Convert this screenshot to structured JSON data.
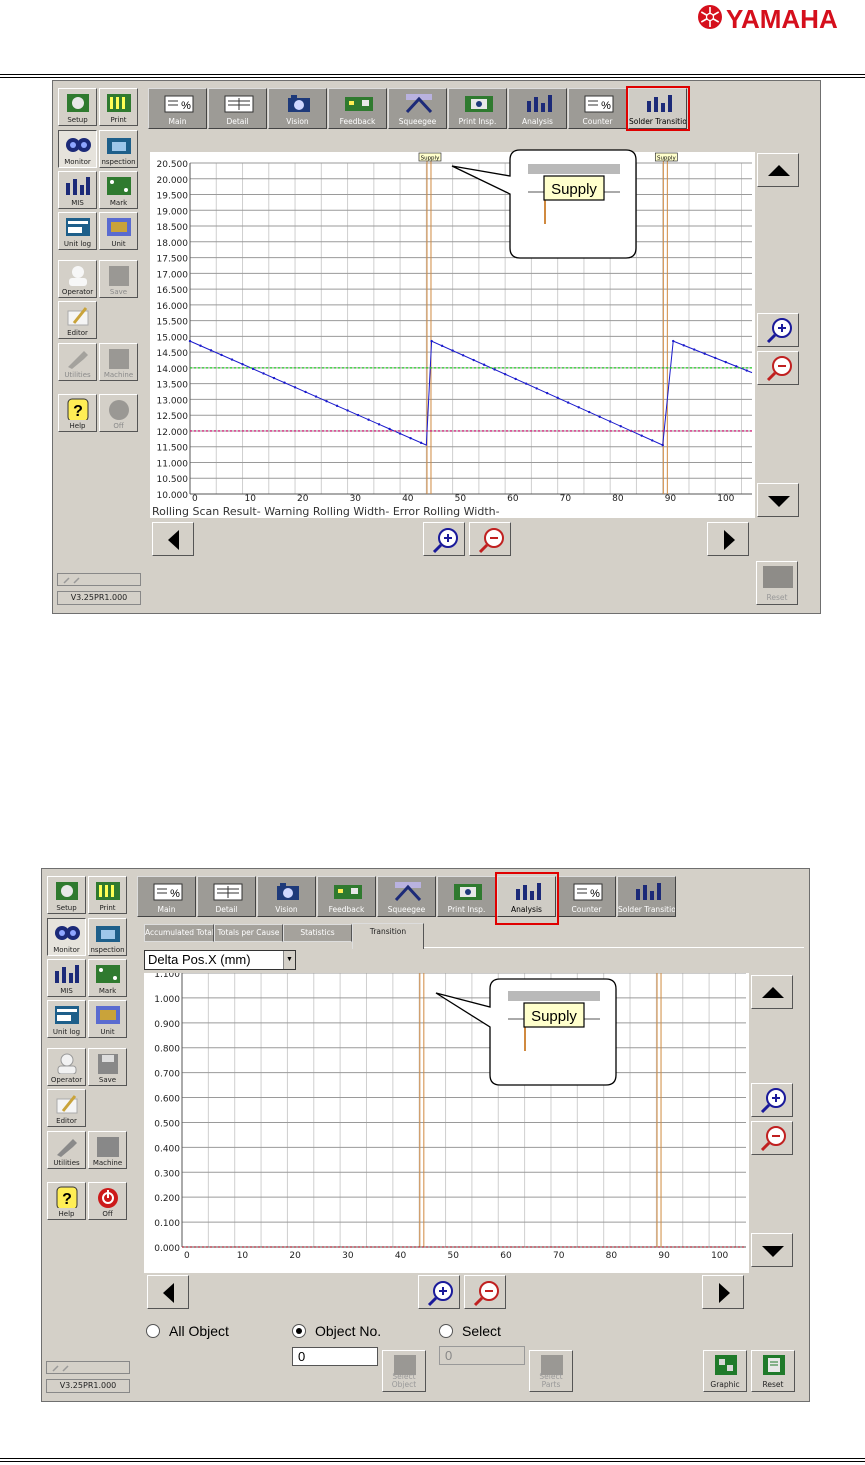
{
  "brand": {
    "name": "YAMAHA"
  },
  "colors": {
    "tab_bg": "#9d9b96",
    "highlight": "#e00000",
    "series": "#1a1acc",
    "warning": "#22cc22",
    "error": "#cc2277",
    "marker": "#d08a40"
  },
  "sidebar": {
    "items": [
      {
        "id": "setup",
        "label": "Setup",
        "icon": "setup-icon"
      },
      {
        "id": "print",
        "label": "Print",
        "icon": "print-icon"
      },
      {
        "id": "monitor",
        "label": "Monitor",
        "icon": "monitor-icon"
      },
      {
        "id": "inspection",
        "label": "nspection",
        "icon": "inspection-icon"
      },
      {
        "id": "mis",
        "label": "MIS",
        "icon": "mis-icon"
      },
      {
        "id": "mark",
        "label": "Mark",
        "icon": "mark-icon"
      },
      {
        "id": "unitlog",
        "label": "Unit log",
        "icon": "unit-log-icon"
      },
      {
        "id": "unit",
        "label": "Unit",
        "icon": "unit-icon"
      },
      {
        "id": "operator",
        "label": "Operator",
        "icon": "operator-icon"
      },
      {
        "id": "save",
        "label": "Save",
        "icon": "save-icon"
      },
      {
        "id": "editor",
        "label": "Editor",
        "icon": "editor-icon"
      },
      {
        "id": "utilities",
        "label": "Utilities",
        "icon": "wrench-icon"
      },
      {
        "id": "machine",
        "label": "Machine",
        "icon": "machine-icon"
      },
      {
        "id": "help",
        "label": "Help",
        "icon": "help-icon"
      },
      {
        "id": "off",
        "label": "Off",
        "icon": "power-icon"
      }
    ],
    "version": "V3.25PR1.000"
  },
  "toolbar": {
    "tabs": [
      "Main",
      "Detail",
      "Vision",
      "Feedback",
      "Squeegee",
      "Print Insp.",
      "Analysis",
      "Counter",
      "Solder Transition"
    ]
  },
  "screen1": {
    "active_tab": "Solder Transition",
    "chart_data": {
      "type": "line",
      "x_ticks": [
        0,
        10,
        20,
        30,
        40,
        50,
        60,
        70,
        80,
        90,
        100
      ],
      "xlim": [
        0,
        107
      ],
      "ylim": [
        10000,
        20500
      ],
      "y_ticks": [
        "20.500",
        "20.000",
        "19.500",
        "19.000",
        "18.500",
        "18.000",
        "17.500",
        "17.000",
        "16.500",
        "16.000",
        "15.500",
        "15.000",
        "14.500",
        "14.000",
        "13.500",
        "13.000",
        "12.500",
        "12.000",
        "11.500",
        "11.000",
        "10.500",
        "10.000"
      ],
      "grid": true,
      "series": [
        {
          "name": "Rolling Scan Result",
          "x": [
            0,
            45,
            46,
            90,
            92,
            107
          ],
          "y": [
            14850,
            11550,
            14850,
            11550,
            14850,
            13850
          ]
        },
        {
          "name": "Warning Rolling Width",
          "x": [
            0,
            107
          ],
          "y": [
            14000,
            14000
          ]
        },
        {
          "name": "Error Rolling Width",
          "x": [
            0,
            107
          ],
          "y": [
            12000,
            12000
          ]
        }
      ],
      "markers": [
        {
          "x": 45.5,
          "label": "Supply"
        },
        {
          "x": 90.5,
          "label": "Supply"
        }
      ],
      "legend_text": "Rolling Scan Result- Warning Rolling Width- Error Rolling Width-",
      "legend_position": "bottom"
    },
    "callout_label": "Supply",
    "reset_label": "Reset"
  },
  "screen2": {
    "active_tab": "Analysis",
    "subtabs": [
      "Accumulated Total",
      "Totals per Cause",
      "Statistics",
      "Transition"
    ],
    "dropdown_value": "Delta Pos.X (mm)",
    "chart_data": {
      "type": "line",
      "x_ticks": [
        0,
        10,
        20,
        30,
        40,
        50,
        60,
        70,
        80,
        90,
        100
      ],
      "xlim": [
        0,
        107
      ],
      "ylim": [
        0.0,
        1.1
      ],
      "y_ticks": [
        "1.100",
        "1.000",
        "0.900",
        "0.800",
        "0.700",
        "0.600",
        "0.500",
        "0.400",
        "0.300",
        "0.200",
        "0.100",
        "0.000"
      ],
      "grid": true,
      "series": [
        {
          "name": "Delta Pos.X",
          "x": [
            0,
            107
          ],
          "y": [
            0.0,
            0.0
          ]
        }
      ],
      "markers": [
        {
          "x": 45.5,
          "label": "Supply"
        },
        {
          "x": 90.5,
          "label": "Supply"
        }
      ]
    },
    "callout_label": "Supply",
    "radios": [
      {
        "label": "All Object",
        "checked": false
      },
      {
        "label": "Object No.",
        "checked": true
      },
      {
        "label": "Select",
        "checked": false
      }
    ],
    "object_no_value": "0",
    "select_value": "0",
    "select_object_label": "Select Object",
    "select_parts_label": "Select Parts",
    "graphic_label": "Graphic",
    "reset_label": "Reset"
  }
}
